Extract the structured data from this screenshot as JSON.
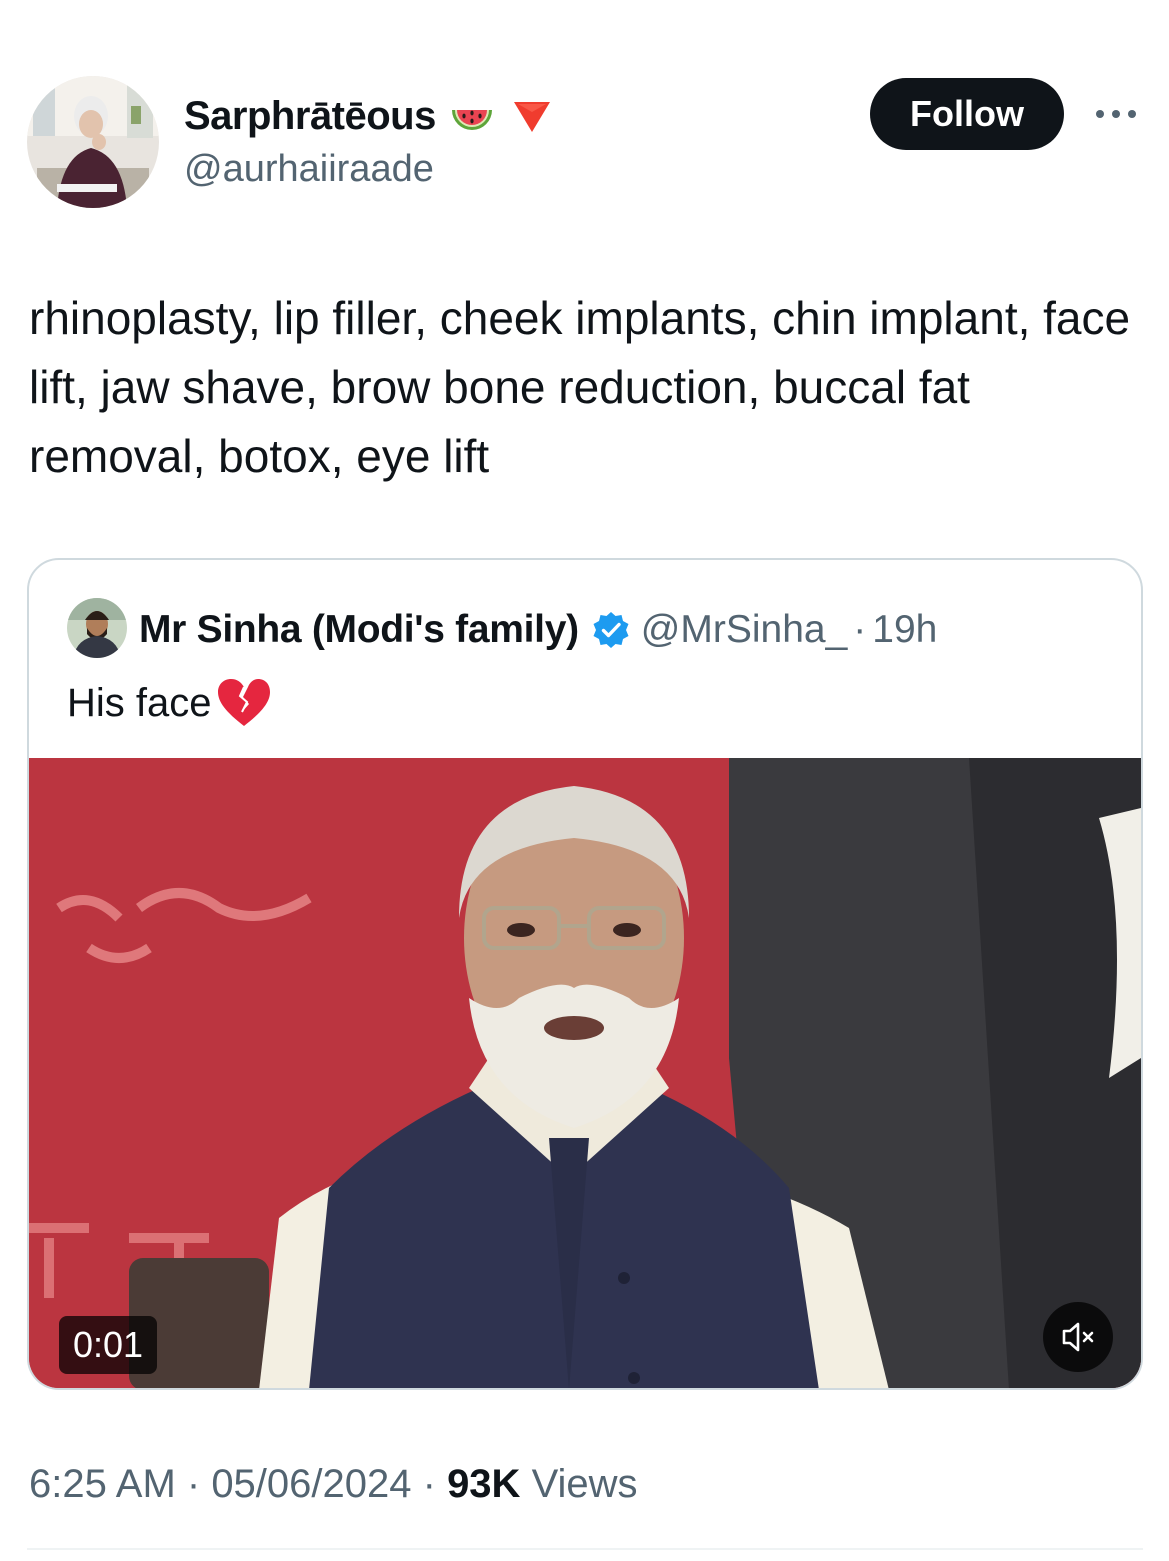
{
  "author": {
    "display_name": "Sarphrātēous",
    "handle": "@aurhaiiraade",
    "name_emojis": [
      "watermelon-icon",
      "red-triangle-down-icon"
    ]
  },
  "follow_label": "Follow",
  "tweet": {
    "text": "rhinoplasty, lip filler, cheek implants, chin implant, face lift, jaw shave, brow bone reduction, buccal fat removal, botox, eye lift"
  },
  "quote": {
    "display_name": "Mr Sinha (Modi's family)",
    "handle": "@MrSinha_",
    "separator": "·",
    "time": "19h",
    "text": "His face",
    "text_emoji": "broken-heart-icon",
    "verified": true,
    "video": {
      "elapsed": "0:01",
      "muted": true
    }
  },
  "footer": {
    "time": "6:25 AM",
    "sep1": " · ",
    "date": "05/06/2024",
    "sep2": " · ",
    "views_count": "93K",
    "views_label": " Views"
  },
  "colors": {
    "text_primary": "#0f1419",
    "text_secondary": "#536471",
    "verified_blue": "#1d9bf0",
    "follow_bg": "#0f1419",
    "border": "#cfd9de"
  }
}
